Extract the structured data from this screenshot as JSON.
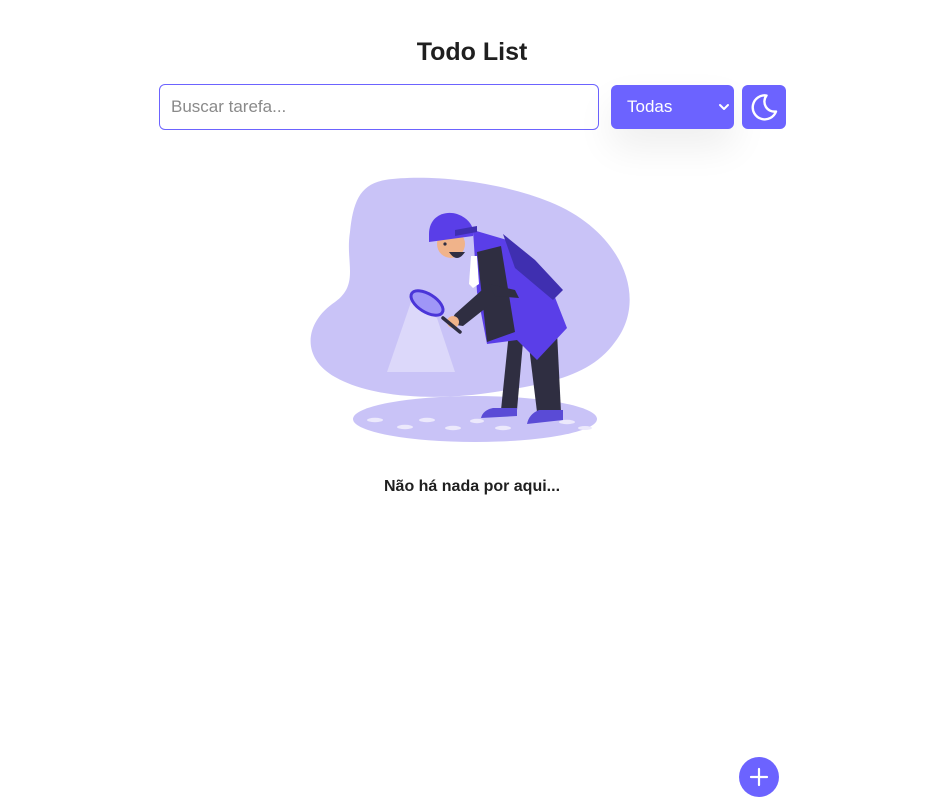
{
  "header": {
    "title": "Todo List"
  },
  "toolbar": {
    "search": {
      "placeholder": "Buscar tarefa...",
      "value": ""
    },
    "filter": {
      "selected": "Todas"
    },
    "theme_toggle": {
      "icon": "moon-icon"
    }
  },
  "empty_state": {
    "illustration": "detective-magnifying-glass-illustration",
    "message": "Não há nada por aqui..."
  },
  "fab": {
    "icon": "plus-icon"
  },
  "colors": {
    "accent": "#6c63ff",
    "blob": "#c9c3f7",
    "text": "#1f1f1f",
    "background": "#ffffff"
  }
}
